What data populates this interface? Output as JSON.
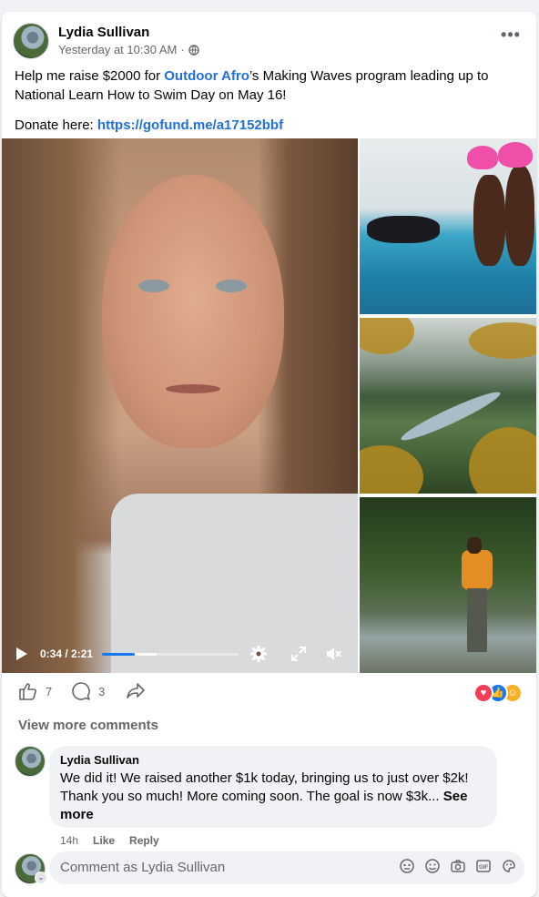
{
  "post": {
    "author": "Lydia Sullivan",
    "timestamp": "Yesterday at 10:30 AM",
    "separator": "·",
    "more_label": "•••",
    "text_pre": "Help me raise $2000 for ",
    "text_link": "Outdoor Afro",
    "text_post": "’s Making Waves program leading up to National Learn How to Swim Day on May 16!",
    "donate_label": "Donate here: ",
    "donate_url": "https://gofund.me/a17152bbf"
  },
  "video": {
    "time": "0:34 / 2:21",
    "played_fraction": 0.24,
    "buffered_fraction": 0.4
  },
  "actions": {
    "like_count": "7",
    "comment_count": "3"
  },
  "reactions": [
    "love",
    "like",
    "care"
  ],
  "view_more_comments": "View more comments",
  "comment": {
    "author": "Lydia Sullivan",
    "text": "We did it! We raised another $1k today, bringing us to just over $2k! Thank you so much! More coming soon. The goal is now $3k...",
    "see_more": "See more",
    "age": "14h",
    "like": "Like",
    "reply": "Reply"
  },
  "composer": {
    "placeholder": "Comment as Lydia Sullivan"
  },
  "colors": {
    "link": "#216fdb",
    "like_blue": "#1877f2",
    "love_red": "#f33e58",
    "care_yellow": "#f7b125"
  }
}
